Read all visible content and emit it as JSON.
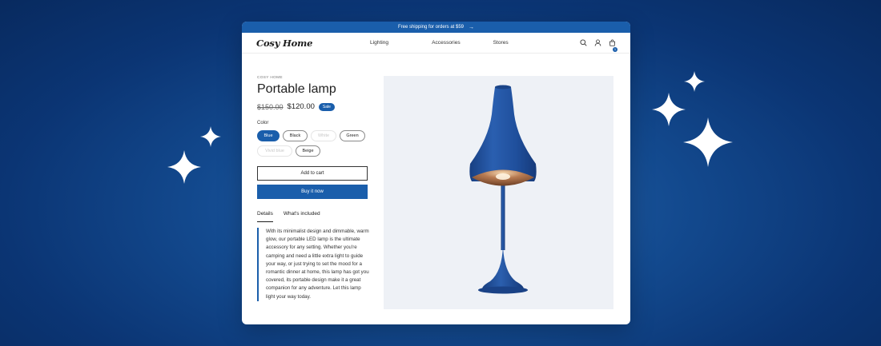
{
  "announcement": {
    "text": "Free shipping for orders at $59",
    "arrow": "→"
  },
  "header": {
    "logo": "Cosy Home",
    "nav": [
      "Lighting",
      "Accessories",
      "Stores"
    ],
    "cart_count": "1",
    "icons": [
      "search-icon",
      "account-icon",
      "cart-icon"
    ]
  },
  "product": {
    "brand": "COSY HOME",
    "title": "Portable lamp",
    "old_price": "$150.00",
    "price": "$120.00",
    "sale_badge": "Sale",
    "color_label": "Color",
    "colors": [
      {
        "label": "Blue",
        "state": "selected"
      },
      {
        "label": "Black",
        "state": "available"
      },
      {
        "label": "White",
        "state": "unavailable"
      },
      {
        "label": "Green",
        "state": "available"
      },
      {
        "label": "Vivid blue",
        "state": "unavailable"
      },
      {
        "label": "Beige",
        "state": "available"
      }
    ],
    "add_to_cart": "Add to cart",
    "buy_now": "Buy it now",
    "tabs": [
      "Details",
      "What's included"
    ],
    "description": "With its minimalist design and dimmable, warm glow, our portable LED lamp is the ultimate accessory for any setting. Whether you're camping and need a little extra light to guide your way, or just trying to set the mood for a romantic dinner at home, this lamp has got you covered, its portable design make it a great companion for any adventure. Let this lamp light your way today."
  },
  "colors": {
    "accent": "#1a5eab",
    "background": "#0b3574",
    "image_bg": "#eef1f6",
    "lamp": "#1e4f9e"
  }
}
